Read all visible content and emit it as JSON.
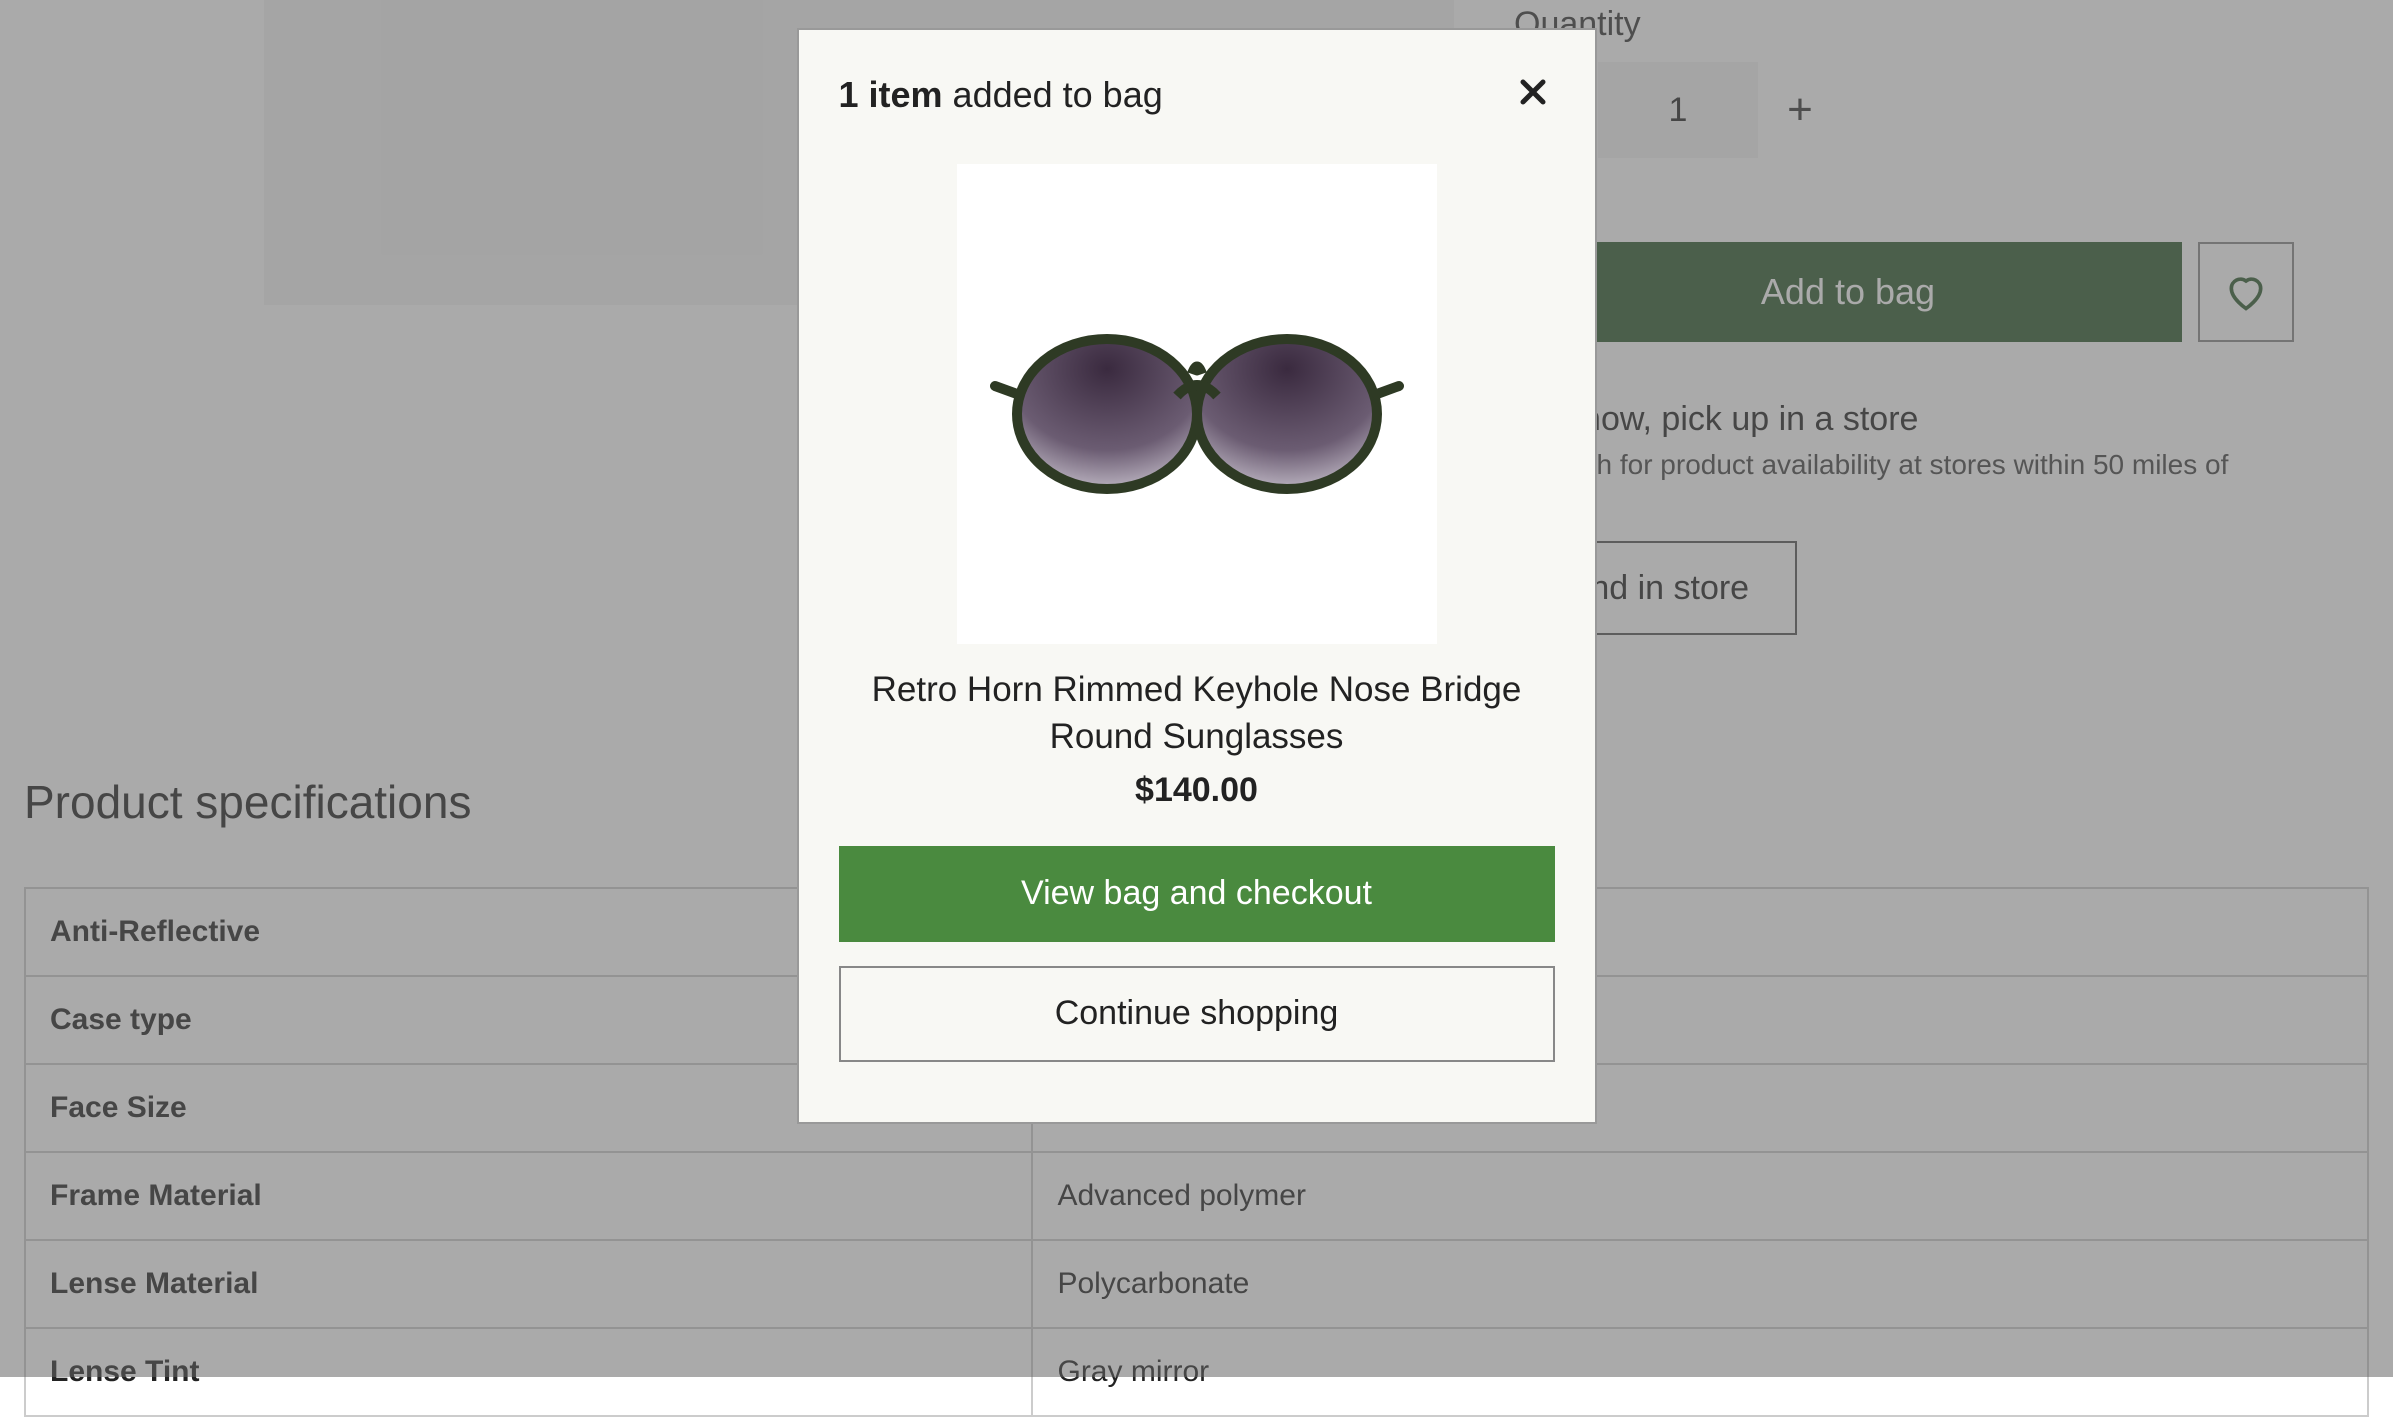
{
  "hero": {
    "quantity_label": "Quantity",
    "quantity_value": "1",
    "add_to_bag_label": "Add to bag",
    "pickup_title": "Buy now, pick up in a store",
    "pickup_sub": "{Search for product availability at stores within 50 miles of you.}",
    "find_store_label": "Find in store"
  },
  "specs": {
    "heading": "Product specifications",
    "rows": [
      {
        "label": "Anti-Reflective",
        "value": ""
      },
      {
        "label": "Case type",
        "value": ""
      },
      {
        "label": "Face Size",
        "value": ""
      },
      {
        "label": "Frame Material",
        "value": "Advanced polymer"
      },
      {
        "label": "Lense Material",
        "value": "Polycarbonate"
      },
      {
        "label": "Lense Tint",
        "value": "Gray mirror"
      }
    ]
  },
  "modal": {
    "title_bold": "1 item",
    "title_rest": " added to bag",
    "product_name": "Retro Horn Rimmed Keyhole Nose Bridge Round Sunglasses",
    "product_price": "$140.00",
    "view_bag_label": "View bag and checkout",
    "continue_label": "Continue shopping"
  },
  "icons": {
    "minus": "minus-icon",
    "plus": "plus-icon",
    "heart": "heart-icon",
    "close": "close-icon"
  },
  "colors": {
    "brand_dark_green": "#2d5a2d",
    "brand_green": "#4a8a3f",
    "modal_bg": "#f8f8f4"
  }
}
